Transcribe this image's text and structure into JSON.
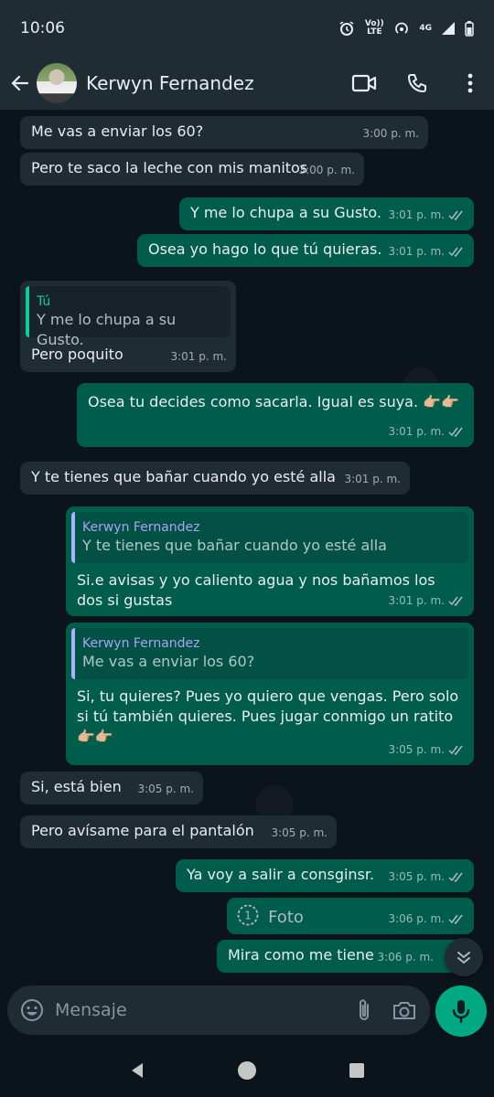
{
  "status": {
    "time": "10:06",
    "volte": "Vo)) LTE",
    "network": "4G"
  },
  "header": {
    "name": "Kerwyn Fernandez"
  },
  "messages": [
    {
      "text": "Me vas a enviar los 60?",
      "time": "3:00 p. m."
    },
    {
      "text": "Pero te saco la leche con mis manitos",
      "time": "3:00 p. m."
    },
    {
      "text": "Y me lo chupa a su Gusto.",
      "time": "3:01 p. m."
    },
    {
      "text": "Osea yo hago lo que tú quieras.",
      "time": "3:01 p. m."
    },
    {
      "quote_author": "Tú",
      "quote_text": "Y me lo chupa a su Gusto.",
      "text": "Pero poquito",
      "time": "3:01 p. m."
    },
    {
      "text": "Osea tu decides como sacarla. Igual es suya. 👉🏼👉🏼",
      "time": "3:01 p. m."
    },
    {
      "text": "Y te tienes que bañar cuando yo esté alla",
      "time": "3:01 p. m."
    },
    {
      "quote_author": "Kerwyn Fernandez",
      "quote_text": "Y te tienes que bañar cuando yo esté alla",
      "text": "Si.e avisas y yo caliento agua y nos bañamos los dos si gustas",
      "time": "3:01 p. m."
    },
    {
      "quote_author": "Kerwyn Fernandez",
      "quote_text": "Me vas a enviar los 60?",
      "text": "Si, tu quieres?  Pues yo quiero que vengas. Pero solo si tú también quieres. Pues jugar conmigo un ratito 👉🏼👉🏼",
      "time": "3:05 p. m."
    },
    {
      "text": "Si, está bien",
      "time": "3:05 p. m."
    },
    {
      "text": "Pero avísame para el pantalón",
      "time": "3:05 p. m."
    },
    {
      "text": "Ya voy a salir a consginsr.",
      "time": "3:05 p. m."
    },
    {
      "text": "Foto",
      "time": "3:06 p. m."
    },
    {
      "text": "Mira como me tiene",
      "time": "3:06 p. m."
    }
  ],
  "input": {
    "placeholder": "Mensaje"
  },
  "colors": {
    "incoming": "#1f2c34",
    "outgoing": "#005c4b",
    "accent": "#00a884",
    "background": "#0b141a"
  }
}
